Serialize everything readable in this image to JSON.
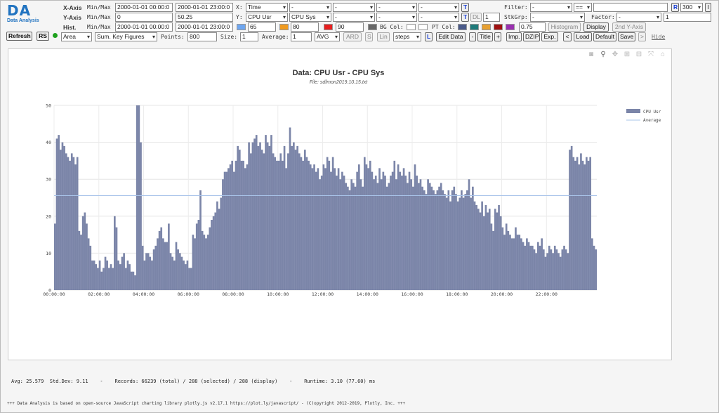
{
  "logo": {
    "mark": "DA",
    "subtitle": "Data Analysis"
  },
  "controls": {
    "xaxis_label": "X-Axis",
    "minmax_label": "Min/Max",
    "x_min": "2000-01-01 00:00:0",
    "x_max": "2000-01-01 23:00:0",
    "yaxis_label": "Y-Axis",
    "y_min": "0",
    "y_max": "50.25",
    "hist_label": "Hist.",
    "hist_min": "2000-01-01 00:00:0",
    "hist_max": "2000-01-01 23:00:0",
    "x_sel_label": "X:",
    "x_sel": "Time",
    "y_sel_label": "Y:",
    "y_sel1": "CPU Usr",
    "y_sel2": "CPU Sys",
    "dash": "-",
    "t_label": "T",
    "dl_label": "DL",
    "dl_value": "1",
    "filter_label": "Filter:",
    "filter_sel": "-",
    "filter_op": "==",
    "filter_value": "",
    "r_label": "R",
    "r_value": "300",
    "i_label": "I",
    "stkgrp_label": "StkGrp:",
    "stkgrp_sel": "-",
    "factor_label": "Factor:",
    "factor_sel": "-",
    "factor_value": "1",
    "thr1": "65",
    "thr2": "80",
    "thr3": "90",
    "bgcol_label": "BG Col:",
    "ptcol_label": "PT Col:",
    "ptcol_value": "0.75",
    "histogram_label": "Histogram",
    "display_label": "Display",
    "second_y_label": "2nd Y-Axis",
    "refresh_label": "Refresh",
    "rs_label": "RS",
    "type_sel": "Area",
    "agg_sel": "Sum. Key Figures",
    "points_label": "Points:",
    "points_value": "800",
    "size_label": "Size:",
    "size_value": "1",
    "average_label": "Average:",
    "average_value": "1",
    "avg_sel": "AVG",
    "ard_label": "ARD",
    "s_label": "S",
    "lin_label": "Lin",
    "steps_sel": "steps",
    "l_label": "L",
    "edit_data_label": "Edit Data",
    "minus_label": "-",
    "title_label": "Title",
    "plus_label": "+",
    "imp_label": "Imp.",
    "dzip_label": "DZIP",
    "exp_label": "Exp.",
    "lt_label": "<",
    "load_label": "Load",
    "default_label": "Default",
    "save_label": "Save",
    "gt_label": ">",
    "hide_label": "Hide"
  },
  "colors": {
    "thr1": "#6ea6f0",
    "thr2": "#f09a1e",
    "thr3": "#e81e1e",
    "bg": "#666666",
    "pt1": "#4a5a8a",
    "pt2": "#1e7a7a",
    "pt3": "#e8a030",
    "pt4": "#a01010",
    "pt5": "#9a30b0",
    "area": "#7b85a8",
    "avg_line": "#a9c4ea"
  },
  "footer": {
    "stats": "Avg: 25.579  Std.Dev: 9.11    -    Records: 66239 (total) / 288 (selected) / 288 (display)    -    Runtime: 3.10 (77.60) ms",
    "credit": "+++ Data Analysis is based on open-source JavaScript charting library plotly.js v2.17.1 https://plot.ly/javascript/ - (C)opyright 2012-2019, Plotly, Inc. +++"
  },
  "chart_data": {
    "type": "area",
    "title": "Data: CPU Usr - CPU Sys",
    "subtitle": "File: sdfmon2019.10.15.txt",
    "ylim": [
      0,
      50
    ],
    "yticks": [
      "0",
      "10",
      "20",
      "30",
      "40",
      "50"
    ],
    "xticks": [
      "00:00:00",
      "02:00:00",
      "04:00:00",
      "06:00:00",
      "08:00:00",
      "10:00:00",
      "12:00:00",
      "14:00:00",
      "16:00:00",
      "18:00:00",
      "20:00:00",
      "22:00:00"
    ],
    "x_start": "00:00:00",
    "x_step_minutes": 5,
    "average_value": 25.58,
    "series": [
      {
        "name": "CPU Usr",
        "values": [
          18,
          41,
          42,
          38,
          40,
          39,
          37,
          36,
          35,
          37,
          36,
          34,
          36,
          16,
          15,
          20,
          21,
          18,
          14,
          12,
          8,
          8,
          7,
          6,
          8,
          5,
          6,
          9,
          8,
          6,
          7,
          6,
          20,
          17,
          8,
          7,
          9,
          10,
          6,
          8,
          7,
          5,
          5,
          4,
          50,
          50,
          40,
          12,
          8,
          10,
          10,
          9,
          8,
          11,
          12,
          14,
          16,
          17,
          14,
          13,
          13,
          18,
          10,
          9,
          8,
          13,
          11,
          10,
          9,
          8,
          7,
          8,
          6,
          6,
          15,
          14,
          18,
          19,
          27,
          16,
          15,
          14,
          15,
          17,
          19,
          20,
          21,
          24,
          22,
          25,
          30,
          32,
          32,
          33,
          34,
          35,
          32,
          35,
          39,
          38,
          35,
          35,
          33,
          34,
          40,
          37,
          40,
          41,
          42,
          39,
          40,
          38,
          37,
          42,
          40,
          39,
          42,
          37,
          36,
          35,
          35,
          37,
          35,
          39,
          33,
          37,
          44,
          39,
          40,
          38,
          39,
          37,
          36,
          35,
          38,
          36,
          35,
          34,
          33,
          34,
          32,
          33,
          30,
          31,
          34,
          33,
          36,
          35,
          32,
          36,
          33,
          31,
          33,
          30,
          32,
          31,
          29,
          28,
          27,
          30,
          29,
          28,
          32,
          34,
          30,
          28,
          36,
          34,
          33,
          35,
          32,
          30,
          31,
          29,
          33,
          30,
          32,
          31,
          28,
          29,
          31,
          32,
          35,
          30,
          34,
          32,
          31,
          33,
          31,
          29,
          32,
          30,
          28,
          34,
          31,
          29,
          30,
          28,
          27,
          26,
          30,
          29,
          28,
          27,
          26,
          27,
          28,
          29,
          27,
          26,
          25,
          27,
          24,
          27,
          28,
          26,
          24,
          25,
          27,
          25,
          26,
          27,
          30,
          25,
          28,
          24,
          23,
          22,
          21,
          24,
          20,
          23,
          21,
          22,
          18,
          16,
          22,
          21,
          23,
          20,
          17,
          15,
          18,
          16,
          15,
          14,
          14,
          17,
          15,
          15,
          14,
          13,
          12,
          14,
          13,
          12,
          12,
          11,
          10,
          13,
          12,
          14,
          11,
          9,
          10,
          12,
          11,
          10,
          12,
          11,
          10,
          9,
          11,
          12,
          11,
          10,
          38,
          39,
          36,
          35,
          36,
          34,
          37,
          35,
          34,
          36,
          35,
          36,
          14,
          12,
          11
        ]
      }
    ],
    "legend": [
      "CPU Usr",
      "Average"
    ]
  }
}
